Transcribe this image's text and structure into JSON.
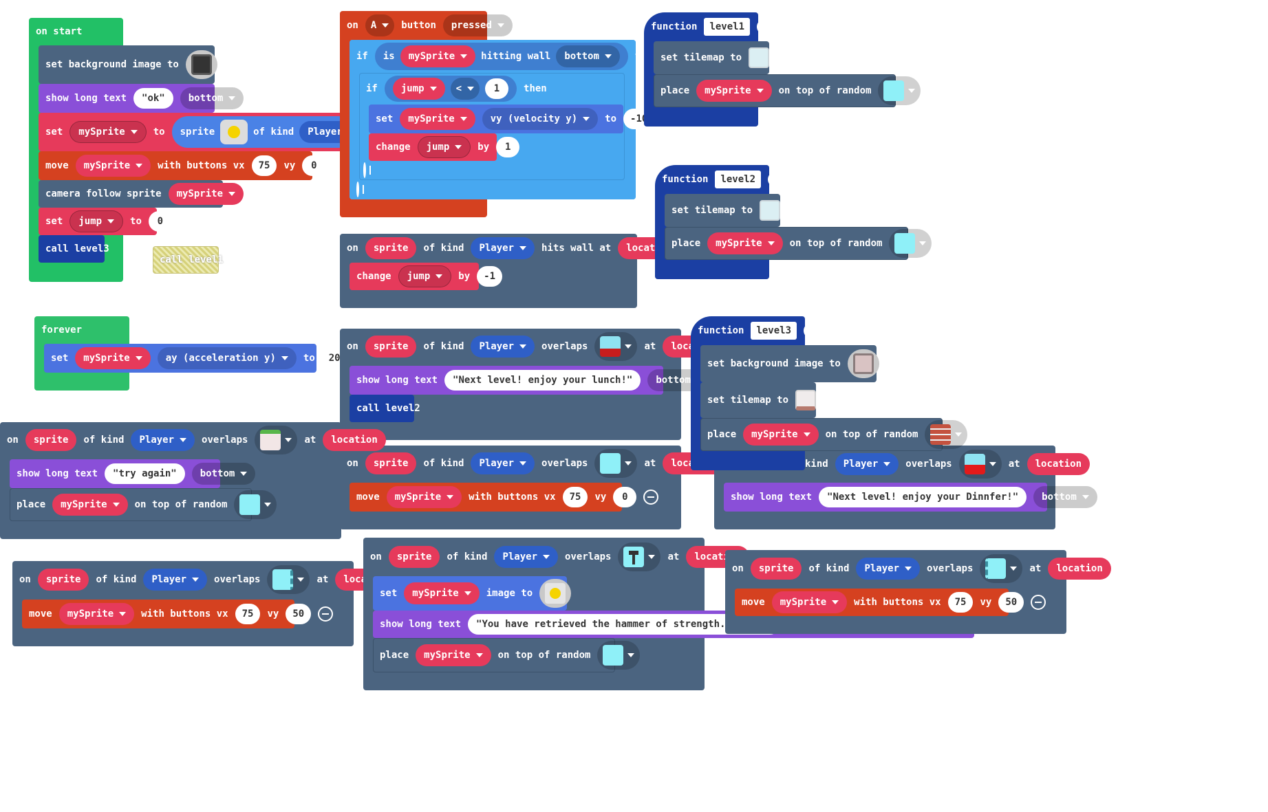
{
  "on_start": {
    "hat": "on start",
    "set_bg": "set background image to",
    "show_long": "show long text",
    "show_text": "\"ok\"",
    "show_pos": "bottom",
    "set": "set",
    "var": "mySprite",
    "to": "to",
    "sprite": "sprite",
    "of_kind": "of kind",
    "kind": "Player",
    "move": "move",
    "with_buttons_vx": "with buttons vx",
    "vx": "75",
    "vy_lbl": "vy",
    "vy": "0",
    "camera": "camera follow sprite",
    "set_jump": "set",
    "jump": "jump",
    "jump_to": "to",
    "jump_val": "0",
    "call": "call level3"
  },
  "disabled_call": "call level1",
  "forever": {
    "hat": "forever",
    "set": "set",
    "var": "mySprite",
    "prop": "ay (acceleration y)",
    "to": "to",
    "val": "200"
  },
  "a_button": {
    "on": "on",
    "btn": "A",
    "label": "button",
    "event": "pressed",
    "if": "if",
    "is": "is",
    "var": "mySprite",
    "hitting": "hitting wall",
    "wall": "bottom",
    "then": "then",
    "if2": "if",
    "jump": "jump",
    "op": "<",
    "val": "1",
    "then2": "then",
    "set": "set",
    "prop": "vy (velocity y)",
    "to": "to",
    "vy": "-100",
    "change": "change",
    "by": "by",
    "by_val": "1"
  },
  "hits_wall": {
    "on": "on",
    "sprite": "sprite",
    "of_kind": "of kind",
    "kind": "Player",
    "hits": "hits wall at",
    "loc": "location",
    "change": "change",
    "jump": "jump",
    "by": "by",
    "val": "-1"
  },
  "overlap_lunch": {
    "on": "on",
    "sprite": "sprite",
    "of_kind": "of kind",
    "kind": "Player",
    "overlaps": "overlaps",
    "at": "at",
    "loc": "location",
    "show_long": "show long text",
    "text": "\"Next level! enjoy your lunch!\"",
    "pos": "bottom",
    "call": "call level2"
  },
  "overlap_mid": {
    "on": "on",
    "sprite": "sprite",
    "of_kind": "of kind",
    "kind": "Player",
    "overlaps": "overlaps",
    "at": "at",
    "loc": "location",
    "move": "move",
    "var": "mySprite",
    "with": "with buttons vx",
    "vx": "75",
    "vy_lbl": "vy",
    "vy": "0"
  },
  "overlap_try": {
    "on": "on",
    "sprite": "sprite",
    "of_kind": "of kind",
    "kind": "Player",
    "overlaps": "overlaps",
    "at": "at",
    "loc": "location",
    "show_long": "show long text",
    "text": "\"try again\"",
    "pos": "bottom",
    "place": "place",
    "var": "mySprite",
    "ontop": "on top of random"
  },
  "overlap_left": {
    "on": "on",
    "sprite": "sprite",
    "of_kind": "of kind",
    "kind": "Player",
    "overlaps": "overlaps",
    "at": "at",
    "loc": "location",
    "move": "move",
    "var": "mySprite",
    "with": "with buttons vx",
    "vx": "75",
    "vy_lbl": "vy",
    "vy": "50"
  },
  "overlap_hammer": {
    "on": "on",
    "sprite": "sprite",
    "of_kind": "of kind",
    "kind": "Player",
    "overlaps": "overlaps",
    "at": "at",
    "loc": "location",
    "set": "set",
    "var": "mySprite",
    "image_to": "image to",
    "show_long": "show long text",
    "text": "\"You have retrieved the hammer of strength. Hold on",
    "place": "place",
    "ontop": "on top of random"
  },
  "overlap_food": {
    "kind_frag": "kind",
    "kind": "Player",
    "overlaps": "overlaps",
    "at": "at",
    "loc": "location",
    "show_long": "show long text",
    "text": "\"Next level! enjoy your Dinnfer!\"",
    "pos": "bottom"
  },
  "overlap_right": {
    "on": "on",
    "sprite": "sprite",
    "of_kind": "of kind",
    "kind": "Player",
    "overlaps": "overlaps",
    "at": "at",
    "loc": "location",
    "move": "move",
    "var": "mySprite",
    "with": "with buttons vx",
    "vx": "75",
    "vy_lbl": "vy",
    "vy": "50"
  },
  "fn1": {
    "kw": "function",
    "name": "level1",
    "set_tm": "set tilemap to",
    "place": "place",
    "var": "mySprite",
    "ontop": "on top of random"
  },
  "fn2": {
    "kw": "function",
    "name": "level2",
    "set_tm": "set tilemap to",
    "place": "place",
    "var": "mySprite",
    "ontop": "on top of random"
  },
  "fn3": {
    "kw": "function",
    "name": "level3",
    "set_bg": "set background image to",
    "set_tm": "set tilemap to",
    "place": "place",
    "var": "mySprite",
    "ontop": "on top of random"
  },
  "colors": {
    "events": "#22c066",
    "sprites": "#e63a5b",
    "scene": "#4b6480",
    "logic": "#47a8f0",
    "game": "#8a4fd8",
    "controller": "#d54120",
    "functions": "#1b3fa3"
  }
}
